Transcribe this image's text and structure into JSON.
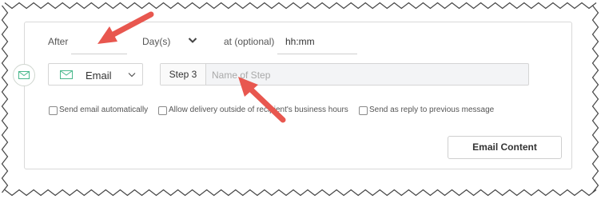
{
  "schedule": {
    "after_label": "After",
    "after_value": "",
    "unit": "Day(s)",
    "at_label": "at (optional)",
    "time_placeholder": "hh:mm"
  },
  "channel": {
    "icon": "envelope-icon",
    "label": "Email"
  },
  "step": {
    "label": "Step 3",
    "name_placeholder": "Name of Step"
  },
  "options": [
    {
      "label": "Send email automatically",
      "checked": false
    },
    {
      "label": "Allow delivery outside of recipient's business hours",
      "checked": false
    },
    {
      "label": "Send as reply to previous message",
      "checked": false
    }
  ],
  "content_button": "Email Content",
  "colors": {
    "annotation_arrow": "#e8574f",
    "email_icon": "#49b88c"
  }
}
